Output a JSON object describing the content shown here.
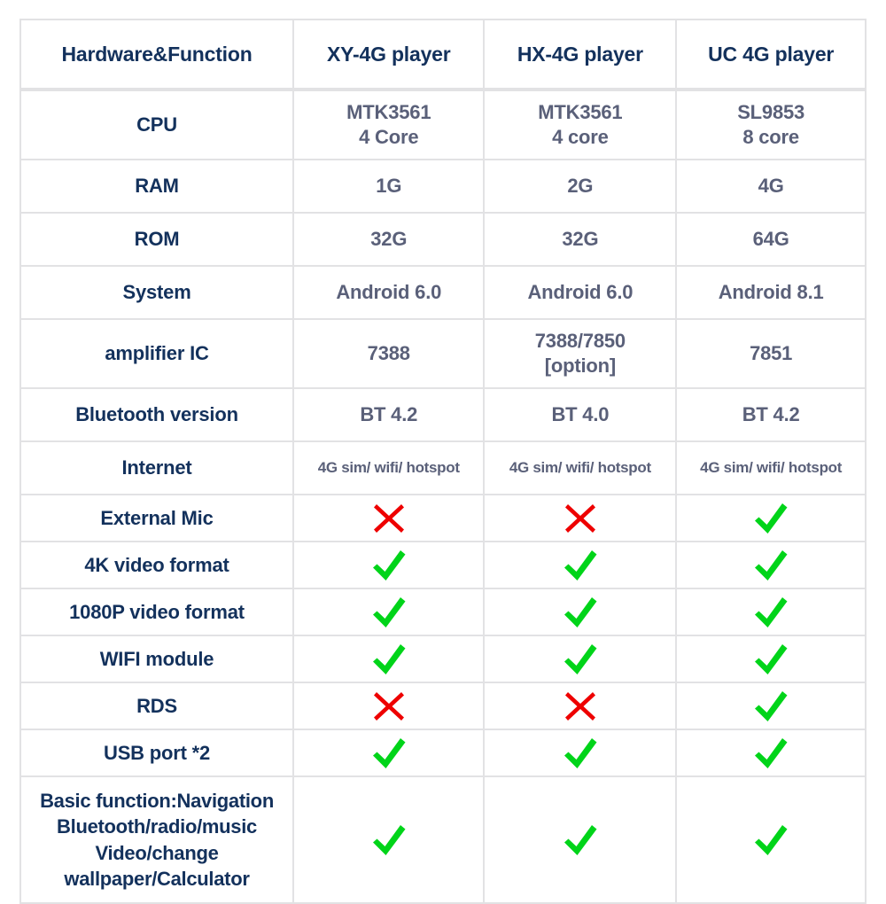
{
  "table": {
    "columns": [
      "Hardware&Function",
      "XY-4G player",
      "HX-4G player",
      "UC 4G player"
    ],
    "colors": {
      "header_text": "#13315C",
      "label_text": "#13315C",
      "value_text": "#5A6079",
      "border": "#E2E2E4",
      "check_green": "#00D419",
      "cross_red": "#EE0000",
      "background": "#FFFFFF"
    },
    "rows": [
      {
        "label": "CPU",
        "type": "text",
        "values": [
          "MTK3561\n4 Core",
          "MTK3561\n4 core",
          "SL9853\n8 core"
        ]
      },
      {
        "label": "RAM",
        "type": "text",
        "values": [
          "1G",
          "2G",
          "4G"
        ]
      },
      {
        "label": "ROM",
        "type": "text",
        "values": [
          "32G",
          "32G",
          "64G"
        ]
      },
      {
        "label": "System",
        "type": "text",
        "values": [
          "Android 6.0",
          "Android 6.0",
          "Android 8.1"
        ]
      },
      {
        "label": "amplifier IC",
        "type": "text",
        "values": [
          "7388",
          "7388/7850\n[option]",
          "7851"
        ]
      },
      {
        "label": "Bluetooth version",
        "type": "text",
        "values": [
          "BT 4.2",
          "BT 4.0",
          "BT 4.2"
        ]
      },
      {
        "label": "Internet",
        "type": "text-small",
        "values": [
          "4G sim/ wifi/ hotspot",
          "4G sim/ wifi/ hotspot",
          "4G sim/ wifi/ hotspot"
        ]
      },
      {
        "label": "External Mic",
        "type": "mark",
        "values": [
          "cross",
          "cross",
          "check"
        ]
      },
      {
        "label": "4K video format",
        "type": "mark",
        "values": [
          "check",
          "check",
          "check"
        ]
      },
      {
        "label": "1080P video format",
        "type": "mark",
        "values": [
          "check",
          "check",
          "check"
        ]
      },
      {
        "label": "WIFI module",
        "type": "mark",
        "values": [
          "check",
          "check",
          "check"
        ]
      },
      {
        "label": "RDS",
        "type": "mark",
        "values": [
          "cross",
          "cross",
          "check"
        ]
      },
      {
        "label": "USB port *2",
        "type": "mark",
        "values": [
          "check",
          "check",
          "check"
        ]
      },
      {
        "label": "Basic function:Navigation\nBluetooth/radio/music\nVideo/change\nwallpaper/Calculator",
        "type": "mark",
        "values": [
          "check",
          "check",
          "check"
        ]
      }
    ]
  }
}
